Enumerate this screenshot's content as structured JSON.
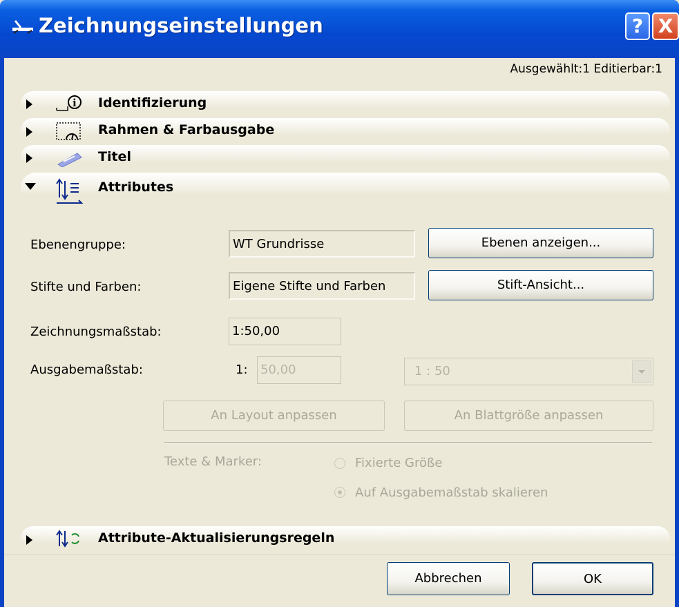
{
  "window": {
    "title": "Zeichnungseinstellungen",
    "help_label": "?",
    "close_label": "X"
  },
  "status": "Ausgewählt:1 Editierbar:1",
  "panels": {
    "identifizierung": "Identifizierung",
    "rahmen": "Rahmen & Farbausgabe",
    "titel": "Titel",
    "attributes": "Attributes",
    "aktualisierung": "Attribute-Aktualisierungsregeln"
  },
  "attributes": {
    "layer_group_label": "Ebenengruppe:",
    "layer_group_value": "WT Grundrisse",
    "show_layers_button": "Ebenen anzeigen...",
    "pens_label": "Stifte und Farben:",
    "pens_value": "Eigene Stifte und Farben",
    "pen_view_button": "Stift-Ansicht...",
    "drawing_scale_label": "Zeichnungsmaßstab:",
    "drawing_scale_value": "1:50,00",
    "output_scale_label": "Ausgabemaßstab:",
    "output_scale_prefix": "1:",
    "output_scale_value": "50,00",
    "output_scale_select": "1 : 50",
    "fit_layout_button": "An Layout anpassen",
    "fit_sheet_button": "An Blattgröße anpassen",
    "texts_markers_label": "Texte & Marker:",
    "fixed_size_option": "Fixierte Größe",
    "scale_option": "Auf Ausgabemaßstab skalieren"
  },
  "footer": {
    "cancel_button": "Abbrechen",
    "ok_button": "OK"
  }
}
